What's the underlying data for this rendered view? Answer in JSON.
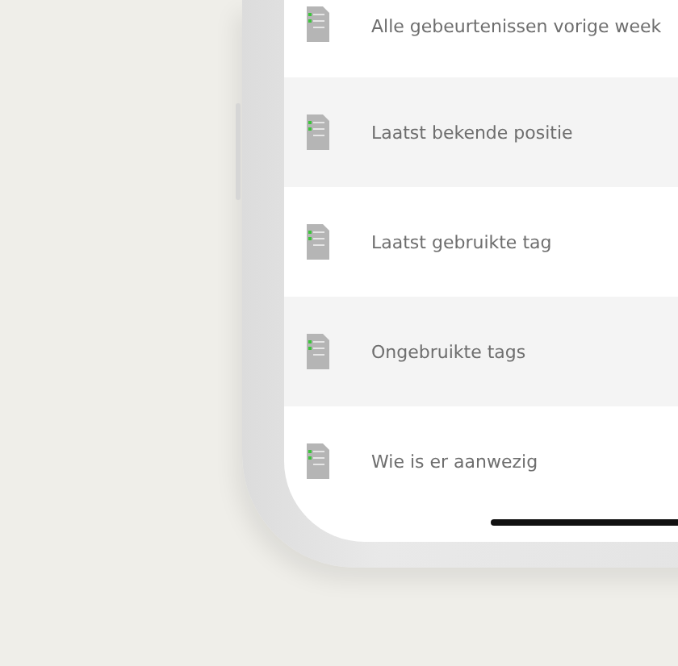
{
  "report_list": {
    "items": [
      {
        "label": "Alle gebeurtenissen vorige week"
      },
      {
        "label": "Laatst bekende positie"
      },
      {
        "label": "Laatst gebruikte tag"
      },
      {
        "label": "Ongebruikte tags"
      },
      {
        "label": "Wie is er aanwezig"
      }
    ]
  }
}
